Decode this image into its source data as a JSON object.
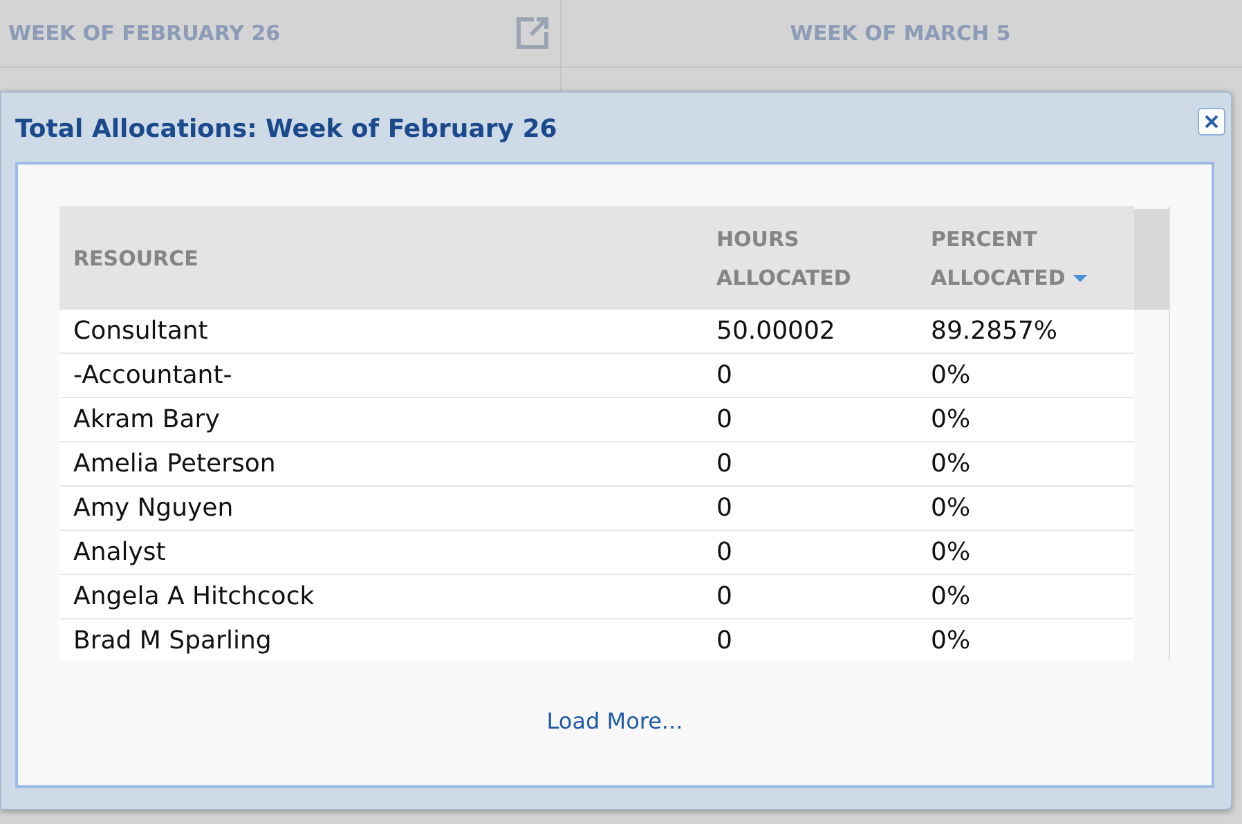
{
  "calendar_header": {
    "columns": [
      {
        "label": "WEEK OF FEBRUARY 26",
        "has_popout": true
      },
      {
        "label": "WEEK OF MARCH 5",
        "has_popout": false
      }
    ]
  },
  "dialog": {
    "title": "Total Allocations: Week of February 26",
    "table": {
      "columns": [
        {
          "label": "RESOURCE",
          "sorted": false
        },
        {
          "label": "HOURS ALLOCATED",
          "sorted": false
        },
        {
          "label": "PERCENT ALLOCATED",
          "sorted": true
        }
      ],
      "rows": [
        [
          "Consultant",
          "50.00002",
          "89.2857%"
        ],
        [
          "-Accountant-",
          "0",
          "0%"
        ],
        [
          "Akram Bary",
          "0",
          "0%"
        ],
        [
          "Amelia Peterson",
          "0",
          "0%"
        ],
        [
          "Amy Nguyen",
          "0",
          "0%"
        ],
        [
          "Analyst",
          "0",
          "0%"
        ],
        [
          "Angela A Hitchcock",
          "0",
          "0%"
        ],
        [
          "Brad M Sparling",
          "0",
          "0%"
        ]
      ]
    },
    "load_more": "Load More..."
  }
}
